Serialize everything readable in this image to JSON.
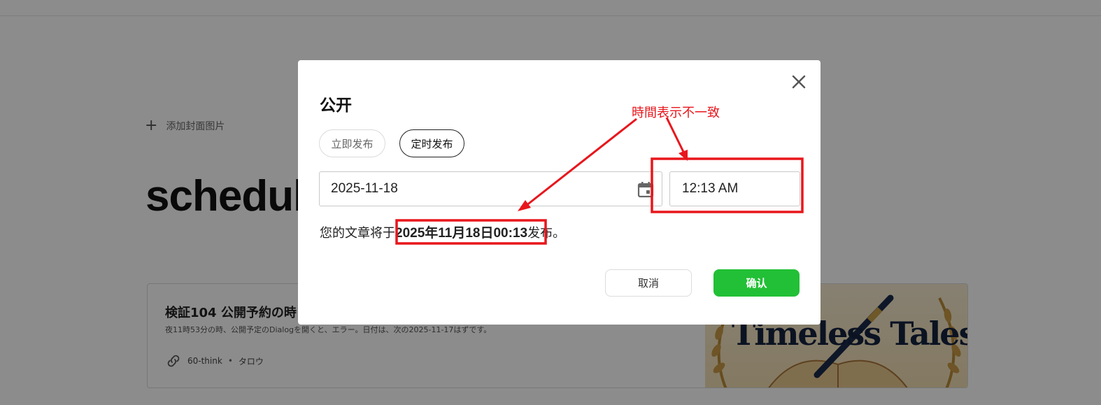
{
  "background": {
    "add_cover_label": "添加封面图片",
    "page_title": "schedul",
    "card": {
      "title": "検証104 公開予約の時",
      "subtitle": "夜11時53分の時、公開予定のDialogを開くと、エラー。日付は、次の2025-11-17はずです。",
      "author_handle": "60-think",
      "separator": "•",
      "author_name": "タロウ",
      "image_text": "Timeless Tales"
    }
  },
  "dialog": {
    "title": "公开",
    "tabs": [
      {
        "label": "立即发布",
        "selected": false
      },
      {
        "label": "定时发布",
        "selected": true
      }
    ],
    "date_value": "2025-11-18",
    "time_value": "12:13 AM",
    "schedule_prefix": "您的文章将于",
    "schedule_datetime": "2025年11月18日00:13",
    "schedule_suffix": "发布。",
    "cancel_label": "取消",
    "confirm_label": "确认"
  },
  "annotation": {
    "label": "時間表示不一致",
    "color": "#e8161c"
  },
  "colors": {
    "confirm_button": "#22c036",
    "overlay": "rgba(0,0,0,0.45)"
  }
}
